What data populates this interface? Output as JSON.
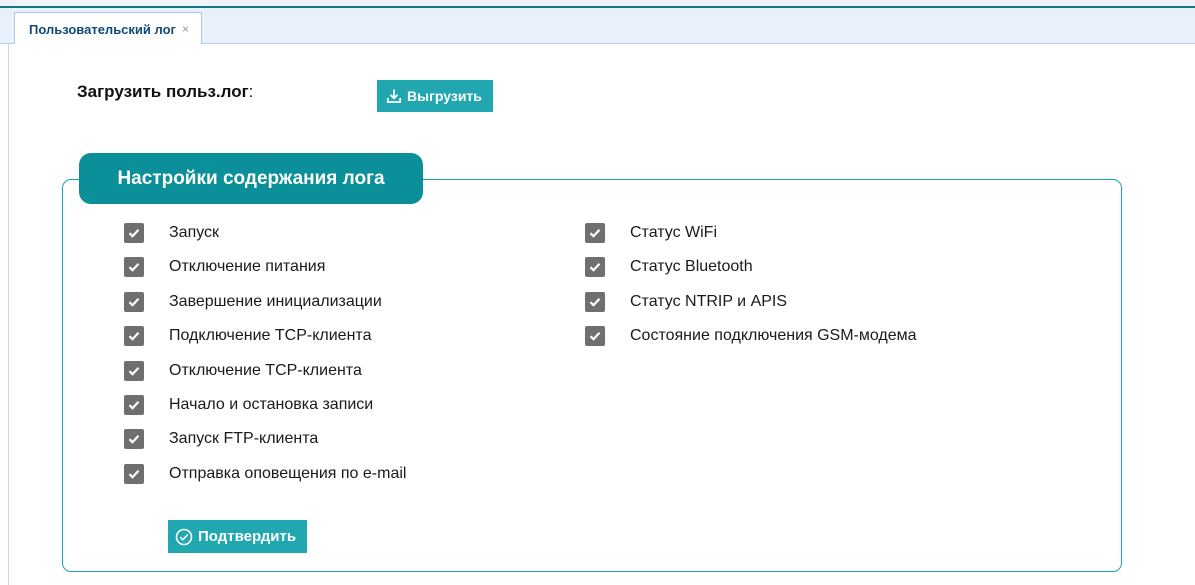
{
  "tabs": [
    {
      "label": "Пользовательский лог",
      "close": "×"
    }
  ],
  "upload": {
    "label": "Загрузить польз.лог",
    "colon": ":",
    "button": "Выгрузить",
    "icon": "download-icon"
  },
  "settings": {
    "legend": "Настройки содержания лога",
    "left_items": [
      {
        "label": "Запуск",
        "checked": true
      },
      {
        "label": "Отключение питания",
        "checked": true
      },
      {
        "label": "Завершение инициализации",
        "checked": true
      },
      {
        "label": "Подключение TCP-клиента",
        "checked": true
      },
      {
        "label": "Отключение TCP-клиента",
        "checked": true
      },
      {
        "label": "Начало и остановка записи",
        "checked": true
      },
      {
        "label": "Запуск FTP-клиента",
        "checked": true
      },
      {
        "label": "Отправка оповещения по e-mail",
        "checked": true
      }
    ],
    "right_items": [
      {
        "label": "Статус WiFi",
        "checked": true
      },
      {
        "label": "Статус Bluetooth",
        "checked": true
      },
      {
        "label": "Статус NTRIP и APIS",
        "checked": true
      },
      {
        "label": "Состояние подключения GSM-модема",
        "checked": true
      }
    ],
    "confirm_button": "Подтвердить",
    "confirm_icon": "check-circle-icon"
  },
  "colors": {
    "accent": "#20a7b0",
    "legend_bg": "#0b8f98",
    "checkbox": "#6f6f6f",
    "tab_text": "#0f4a7d"
  }
}
